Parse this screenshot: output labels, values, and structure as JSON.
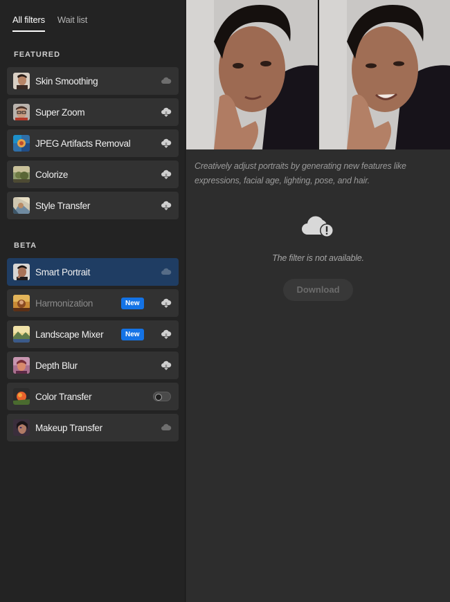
{
  "tabs": [
    {
      "label": "All filters",
      "active": true
    },
    {
      "label": "Wait list",
      "active": false
    }
  ],
  "sections": {
    "featured": "FEATURED",
    "beta": "BETA"
  },
  "featured_filters": [
    {
      "label": "Skin Smoothing",
      "status_icon": "cloud-icon"
    },
    {
      "label": "Super Zoom",
      "status_icon": "cloud-download-icon"
    },
    {
      "label": "JPEG Artifacts Removal",
      "status_icon": "cloud-download-icon"
    },
    {
      "label": "Colorize",
      "status_icon": "cloud-download-icon"
    },
    {
      "label": "Style Transfer",
      "status_icon": "cloud-download-icon"
    }
  ],
  "beta_filters": [
    {
      "label": "Smart Portrait",
      "status_icon": "cloud-icon",
      "selected": true
    },
    {
      "label": "Harmonization",
      "badge": "New",
      "status_icon": "cloud-download-icon",
      "dimmed": true
    },
    {
      "label": "Landscape Mixer",
      "badge": "New",
      "status_icon": "cloud-download-icon"
    },
    {
      "label": "Depth Blur",
      "status_icon": "cloud-download-icon"
    },
    {
      "label": "Color Transfer",
      "status_icon": "toggle-switch-off"
    },
    {
      "label": "Makeup Transfer",
      "status_icon": "cloud-icon"
    }
  ],
  "detail": {
    "description": "Creatively adjust portraits by generating new features like expressions, facial age, lighting, pose, and hair.",
    "unavailable_text": "The filter is not available.",
    "download_label": "Download"
  },
  "colors": {
    "selected": "#1f3d63",
    "badge": "#1473e6",
    "sidebar": "#232323",
    "main": "#2d2d2d"
  }
}
